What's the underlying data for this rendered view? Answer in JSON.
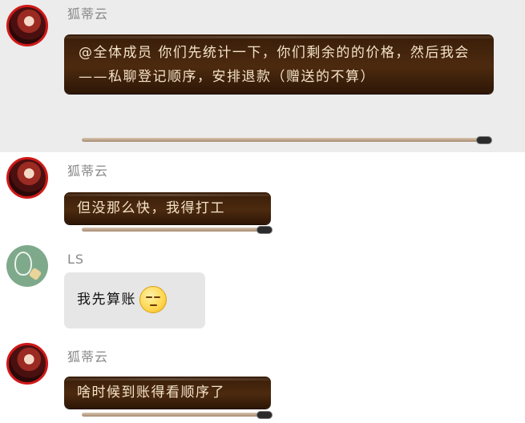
{
  "messages": [
    {
      "sender": "狐蒂云",
      "text": "@全体成员 你们先统计一下，你们剩余的的价格，然后我会——私聊登记顺序，安排退款（赠送的不算）",
      "bubble_style": "dark-brown",
      "highlighted": true
    },
    {
      "sender": "狐蒂云",
      "text": "但没那么快，我得打工",
      "bubble_style": "dark-brown",
      "highlighted": false
    },
    {
      "sender": "LS",
      "text": "我先算账",
      "emoji": "sleepy-face-emoji",
      "bubble_style": "light-gray",
      "highlighted": false
    },
    {
      "sender": "狐蒂云",
      "text": "啥时候到账得看顺序了",
      "bubble_style": "dark-brown",
      "highlighted": false
    }
  ],
  "colors": {
    "highlight_bg": "#ececec",
    "dark_bubble": "#3a1e09",
    "dark_bubble_text": "#f4e3c8",
    "light_bubble": "#e6e6e6",
    "name_text": "#888888",
    "avatar_ring": "#d01818",
    "ls_avatar": "#7fa98b"
  }
}
